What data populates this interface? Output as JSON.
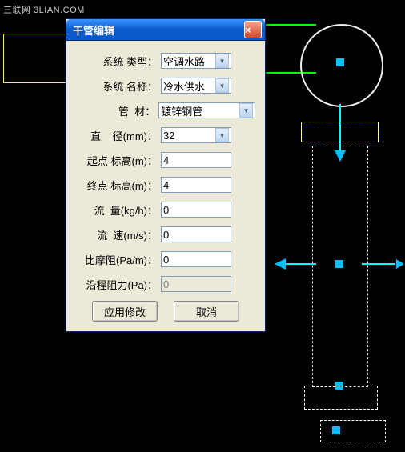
{
  "watermark": "三联网 3LIAN.COM",
  "dialog": {
    "title": "干管编辑",
    "close": "×",
    "rows": {
      "system_type": {
        "label": "系统 类型：",
        "value": "空调水路"
      },
      "system_name": {
        "label": "系统 名称：",
        "value": "冷水供水"
      },
      "material": {
        "label": "管  材：",
        "value": "镀锌钢管"
      },
      "diameter": {
        "label": "直    径(mm)：",
        "value": "32"
      },
      "start_elev": {
        "label": "起点 标高(m)：",
        "value": "4"
      },
      "end_elev": {
        "label": "终点 标高(m)：",
        "value": "4"
      },
      "flow": {
        "label": "流  量(kg/h)：",
        "value": "0"
      },
      "velocity": {
        "label": "流  速(m/s)：",
        "value": "0"
      },
      "friction": {
        "label": "比摩阻(Pa/m)：",
        "value": "0"
      },
      "resistance": {
        "label": "沿程阻力(Pa)：",
        "value": "0"
      }
    },
    "buttons": {
      "apply": "应用修改",
      "cancel": "取消"
    }
  }
}
